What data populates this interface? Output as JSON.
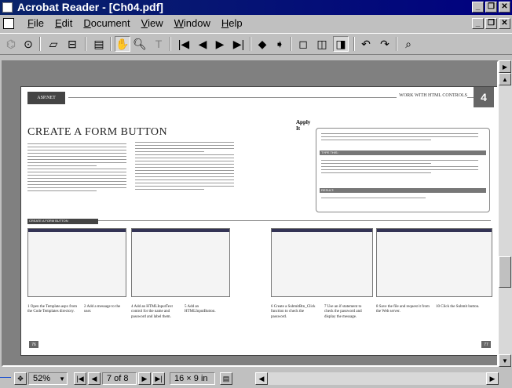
{
  "window": {
    "title": "Acrobat Reader - [Ch04.pdf]"
  },
  "menus": [
    "File",
    "Edit",
    "Document",
    "View",
    "Window",
    "Help"
  ],
  "toolbar": {
    "icons": [
      "acrobat-logo-icon",
      "open-folder-icon",
      "print-icon",
      "page-only-icon",
      "hand-tool-icon",
      "zoom-tool-icon",
      "text-select-icon",
      "first-page-icon",
      "previous-page-icon",
      "next-page-icon",
      "last-page-icon",
      "go-back-icon",
      "go-forward-icon",
      "actual-size-icon",
      "fit-page-icon",
      "fit-width-icon",
      "rotate-left-icon",
      "rotate-right-icon",
      "find-icon"
    ]
  },
  "document": {
    "header_left": "ASP.NET",
    "header_right": "WORK WITH HTML CONTROLS",
    "chapter_number": "4",
    "heading": "CREATE A FORM BUTTON",
    "apply_it": "Apply It",
    "type_this": "TYPE THIS:",
    "result": "RESULT:",
    "section_label": "CREATE A FORM BUTTON",
    "page_left": "76",
    "page_right": "77",
    "steps": [
      "1 Open the Template.aspx from the Code Templates directory.",
      "2 Add a message to the user.",
      "4 Add an HTMLInputText control for the name and password and label them.",
      "5 Add an HTMLInputButton.",
      "6 Create a SubmitBtn_Click function to check the password.",
      "7 Use an if statement to check the password and display the message.",
      "8 Save the file and request it from the Web server.",
      "10 Click the Submit button."
    ]
  },
  "status": {
    "zoom": "52%",
    "page_indicator": "7 of 8",
    "page_size": "16 × 9 in"
  }
}
